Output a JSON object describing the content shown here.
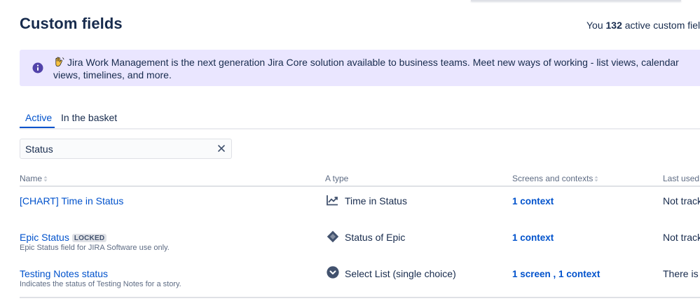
{
  "page": {
    "title": "Custom fields",
    "active_count_prefix": "You ",
    "active_count_value": "132",
    "active_count_suffix": " active custom fields"
  },
  "banner": {
    "icon": "info-icon",
    "emoji": "waving-hand-icon",
    "message": "Jira Work Management is the next generation Jira Core solution available to business teams. Meet new ways of working - list views, calendar views, timelines, and more."
  },
  "tabs": [
    {
      "label": "Active",
      "selected": true
    },
    {
      "label": "In the basket",
      "selected": false
    }
  ],
  "search": {
    "value": "Status",
    "clear_icon": "close-icon"
  },
  "table": {
    "headers": {
      "name": "Name",
      "type": "A type",
      "screens": "Screens and contexts",
      "last_used": "Last used"
    },
    "rows": [
      {
        "name": "[CHART] Time in Status",
        "badge": "",
        "description": "",
        "type_icon": "chart-line-icon",
        "type": "Time in Status",
        "screens": "1 context",
        "last_used": "Not track"
      },
      {
        "name": "Epic Status",
        "badge": "LOCKED",
        "description": "Epic Status field for JIRA Software use only.",
        "type_icon": "diamond-icon",
        "type": "Status of Epic",
        "screens": "1 context",
        "last_used": "Not track"
      },
      {
        "name": "Testing Notes status",
        "badge": "",
        "description": "Indicates the status of Testing Notes for a story.",
        "type_icon": "select-chevron-icon",
        "type": "Select List (single choice)",
        "screens": "1 screen , 1 context",
        "last_used": "There is n"
      }
    ]
  },
  "colors": {
    "link": "#0052cc",
    "text": "#172b4d",
    "subtle": "#5e6c84",
    "banner_bg": "#eae6ff",
    "info_purple": "#5243aa"
  }
}
